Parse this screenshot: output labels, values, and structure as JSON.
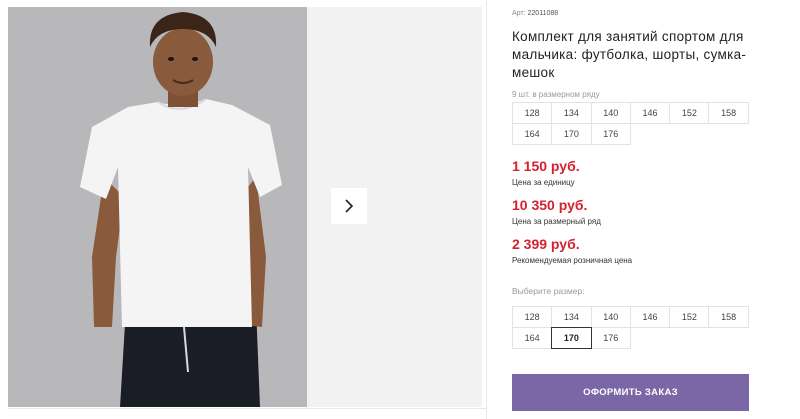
{
  "product": {
    "sku_label": "Арт:",
    "sku_value": "22011088",
    "title": "Комплект для занятий спортом для мальчика: футболка, шорты, сумка-мешок",
    "pack_note": "9 шт. в размерном ряду"
  },
  "size_range": {
    "rows": [
      [
        "128",
        "134",
        "140",
        "146",
        "152",
        "158"
      ],
      [
        "164",
        "170",
        "176"
      ]
    ]
  },
  "prices": {
    "unit_price": "1 150 руб.",
    "unit_label": "Цена за единицу",
    "range_price": "10 350 руб.",
    "range_label": "Цена за размерный ряд",
    "retail_price": "2 399 руб.",
    "retail_label": "Рекомендуемая розничная цена"
  },
  "size_select": {
    "label": "Выберите размер:",
    "rows": [
      [
        "128",
        "134",
        "140",
        "146",
        "152",
        "158"
      ],
      [
        "164",
        "170",
        "176"
      ]
    ],
    "selected": "170"
  },
  "order_button": "ОФОРМИТЬ ЗАКАЗ",
  "gallery": {
    "next_icon": "chevron-right-icon",
    "photo": "boy-in-white-tshirt-photo"
  },
  "colors": {
    "price": "#d6202f",
    "button": "#7b67a6",
    "photo_bg": "#b9b9bb",
    "panel_bg": "#f2f2f2"
  }
}
